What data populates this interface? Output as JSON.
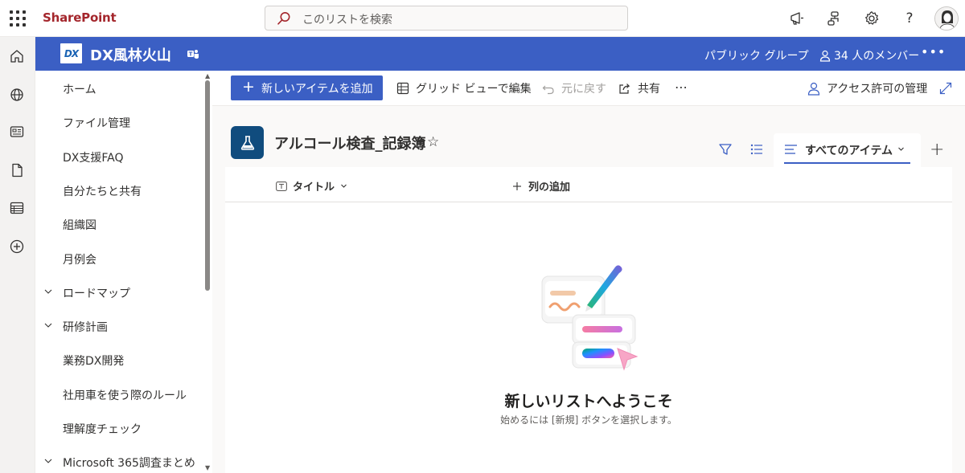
{
  "suite": {
    "app_name": "SharePoint",
    "search_placeholder": "このリストを検索"
  },
  "site": {
    "name": "DX風林火山",
    "logo_text": "DX",
    "group_type": "パブリック グループ",
    "members": "34 人のメンバー"
  },
  "nav": {
    "items": [
      {
        "label": "ホーム",
        "expandable": false
      },
      {
        "label": "ファイル管理",
        "expandable": false
      },
      {
        "label": "DX支援FAQ",
        "expandable": false
      },
      {
        "label": "自分たちと共有",
        "expandable": false
      },
      {
        "label": "組織図",
        "expandable": false
      },
      {
        "label": "月例会",
        "expandable": false
      },
      {
        "label": "ロードマップ",
        "expandable": true
      },
      {
        "label": "研修計画",
        "expandable": true
      },
      {
        "label": "業務DX開発",
        "expandable": false
      },
      {
        "label": "社用車を使う際のルール",
        "expandable": false
      },
      {
        "label": "理解度チェック",
        "expandable": false
      },
      {
        "label": "Microsoft 365調査まとめ",
        "expandable": true
      }
    ]
  },
  "commands": {
    "new_item": "新しいアイテムを追加",
    "grid_view": "グリッド ビューで編集",
    "undo": "元に戻す",
    "share": "共有",
    "more": "⋯",
    "access": "アクセス許可の管理"
  },
  "list": {
    "title": "アルコール検査_記録簿",
    "view_name": "すべてのアイテム",
    "columns": [
      {
        "label": "タイトル"
      }
    ],
    "add_column": "列の追加"
  },
  "empty_state": {
    "title": "新しいリストへようこそ",
    "subtitle": "始めるには [新規] ボタンを選択します。"
  },
  "colors": {
    "brand_red": "#a4262c",
    "site_header": "#3b5fc4",
    "list_icon_bg": "#104c7e"
  }
}
